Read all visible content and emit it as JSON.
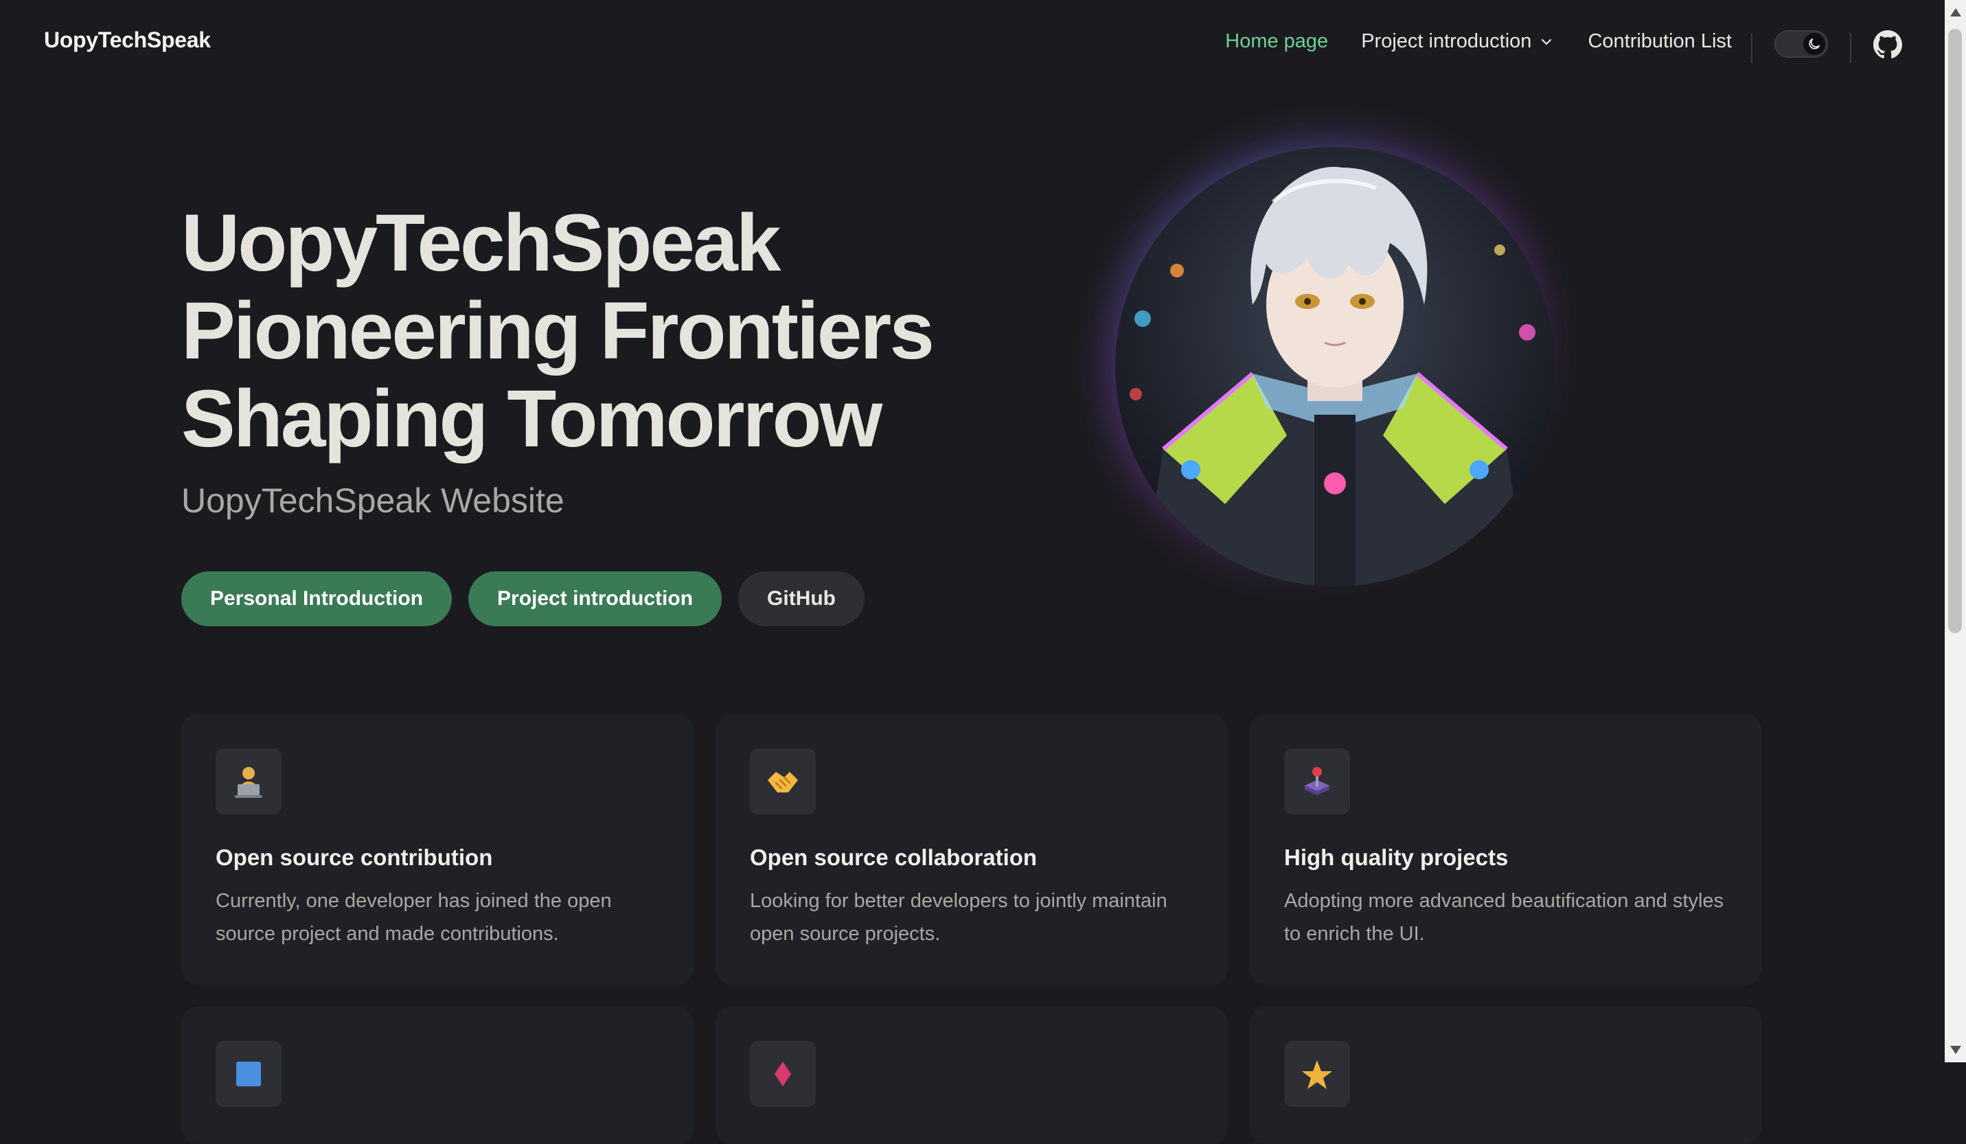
{
  "nav": {
    "brand": "UopyTechSpeak",
    "links": [
      {
        "label": "Home page",
        "active": true
      },
      {
        "label": "Project introduction",
        "dropdown": true
      },
      {
        "label": "Contribution List"
      }
    ],
    "theme_toggle_icon": "moon-icon",
    "repo_icon": "github-icon"
  },
  "hero": {
    "name": "UopyTechSpeak",
    "line1": "Pioneering Frontiers",
    "line2": "Shaping Tomorrow",
    "tagline": "UopyTechSpeak Website",
    "actions": [
      {
        "label": "Personal Introduction",
        "style": "brand"
      },
      {
        "label": "Project introduction",
        "style": "brand"
      },
      {
        "label": "GitHub",
        "style": "alt"
      }
    ]
  },
  "features": [
    {
      "icon": "technologist-emoji",
      "title": "Open source contribution",
      "description": "Currently, one developer has joined the open source project and made contributions."
    },
    {
      "icon": "handshake-emoji",
      "title": "Open source collaboration",
      "description": "Looking for better developers to jointly maintain open source projects."
    },
    {
      "icon": "joystick-emoji",
      "title": "High quality projects",
      "description": "Adopting more advanced beautification and styles to enrich the UI."
    }
  ],
  "colors": {
    "background": "#1b1b1f",
    "accent_green": "#6fcf97",
    "button_green": "#3a7a55",
    "gradient_start": "#5fb4ff",
    "gradient_end": "#b95af0"
  }
}
